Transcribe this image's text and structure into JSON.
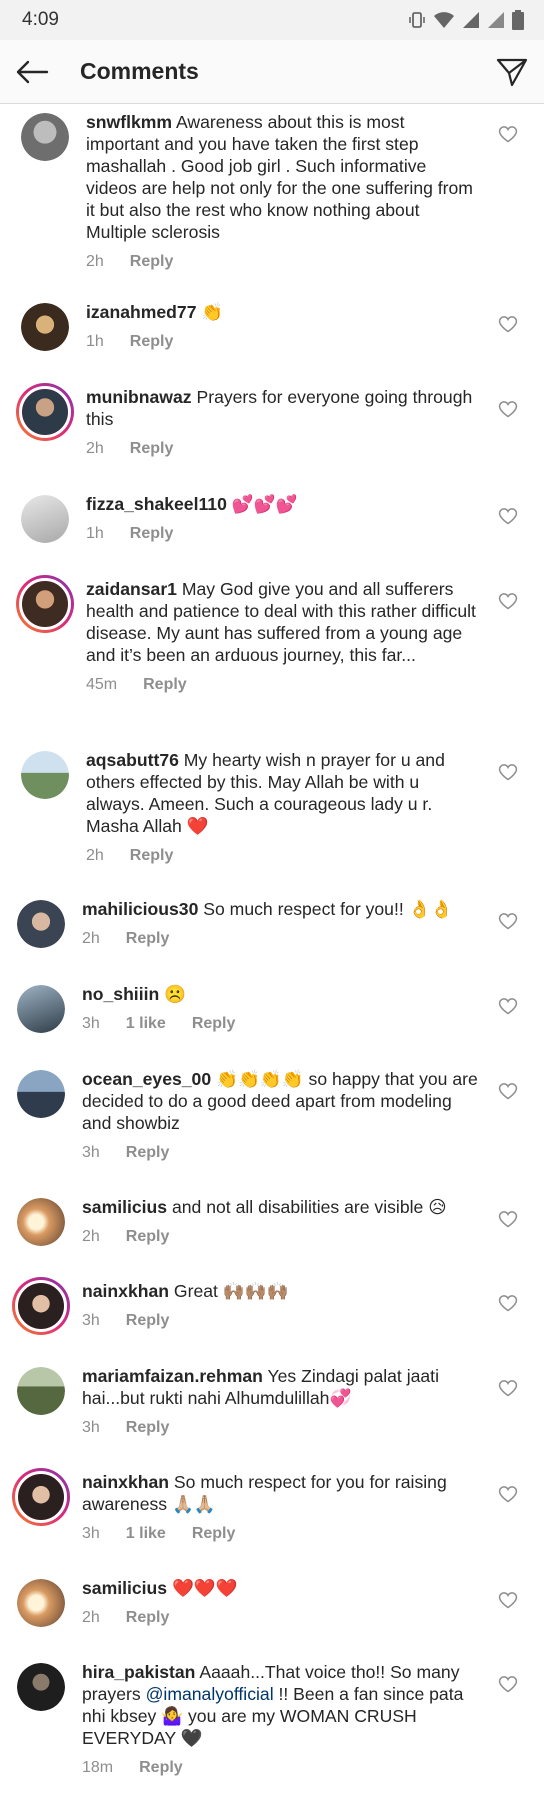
{
  "status_bar": {
    "time": "4:09"
  },
  "header": {
    "title": "Comments"
  },
  "comments": [
    {
      "user": "snwflkmm",
      "text": "Awareness about this is most important and you have taken the first step mashallah . Good job girl . Such informative videos are help not only for the one suffering from it but also the rest who know nothing about Multiple sclerosis",
      "time": "2h",
      "likes": "",
      "reply": "Reply",
      "avatar_color": "#8a8a8a"
    },
    {
      "user": "izanahmed77",
      "text": "👏",
      "time": "1h",
      "likes": "",
      "reply": "Reply",
      "avatar_color": "#b08a5e"
    },
    {
      "user": "munibnawaz",
      "text": "Prayers for everyone going through this",
      "time": "2h",
      "likes": "",
      "reply": "Reply",
      "avatar_color": "#3a4a5a"
    },
    {
      "user": "fizza_shakeel110",
      "text": "💕💕💕",
      "time": "1h",
      "likes": "",
      "reply": "Reply",
      "avatar_color": "#c9c9c9"
    },
    {
      "user": "zaidansar1",
      "text": "May God give you and all sufferers health and patience to deal with this rather difficult disease. My aunt has suffered from a young age and it’s been an arduous journey, this far...",
      "time": "45m",
      "likes": "",
      "reply": "Reply",
      "avatar_color": "#6b4e3a"
    },
    {
      "user": "aqsabutt76",
      "text": "My hearty wish n prayer for u and others effected by this. May Allah be with u always. Ameen. Such a courageous lady u r. Masha Allah ❤️",
      "time": "2h",
      "likes": "",
      "reply": "Reply",
      "avatar_color": "#7c9a7a"
    },
    {
      "user": "mahilicious30",
      "text": "So much respect for you!! 👌👌",
      "time": "2h",
      "likes": "",
      "reply": "Reply",
      "avatar_color": "#4d5a6b"
    },
    {
      "user": "no_shiiin",
      "text": "☹️",
      "time": "3h",
      "likes": "1 like",
      "reply": "Reply",
      "avatar_color": "#5b6f80"
    },
    {
      "user": "ocean_eyes_00",
      "text": "👏👏👏👏 so happy that you are decided to do a good deed apart from modeling and showbiz",
      "time": "3h",
      "likes": "",
      "reply": "Reply",
      "avatar_color": "#4f6a86"
    },
    {
      "user": "samilicius",
      "text": "and not all disabilities are visible 😥",
      "time": "2h",
      "likes": "",
      "reply": "Reply",
      "avatar_color": "#c9a07a"
    },
    {
      "user": "nainxkhan",
      "text": "Great 🙌🏽🙌🏽🙌🏽",
      "time": "3h",
      "likes": "",
      "reply": "Reply",
      "avatar_color": "#3b2f2f"
    },
    {
      "user": "mariamfaizan.rehman",
      "text": "Yes Zindagi palat jaati hai...but rukti nahi Alhumdulillah💞",
      "time": "3h",
      "likes": "",
      "reply": "Reply",
      "avatar_color": "#6f7f5f"
    },
    {
      "user": "nainxkhan",
      "text": "So much respect for you for raising awareness 🙏🏼🙏🏼",
      "time": "3h",
      "likes": "1 like",
      "reply": "Reply",
      "avatar_color": "#3b2f2f"
    },
    {
      "user": "samilicius",
      "text": "❤️❤️❤️",
      "time": "2h",
      "likes": "",
      "reply": "Reply",
      "avatar_color": "#c9a07a"
    },
    {
      "user": "hira_pakistan",
      "text_before": "Aaaah...That voice tho!! So many prayers",
      "mention": "@imanalyofficial",
      "text_after": "!! Been a fan since pata nhi kbsey 🤷‍♀️ you are my WOMAN CRUSH EVERYDAY 🖤",
      "time": "18m",
      "likes": "",
      "reply": "Reply",
      "avatar_color": "#2e2e2e"
    }
  ]
}
